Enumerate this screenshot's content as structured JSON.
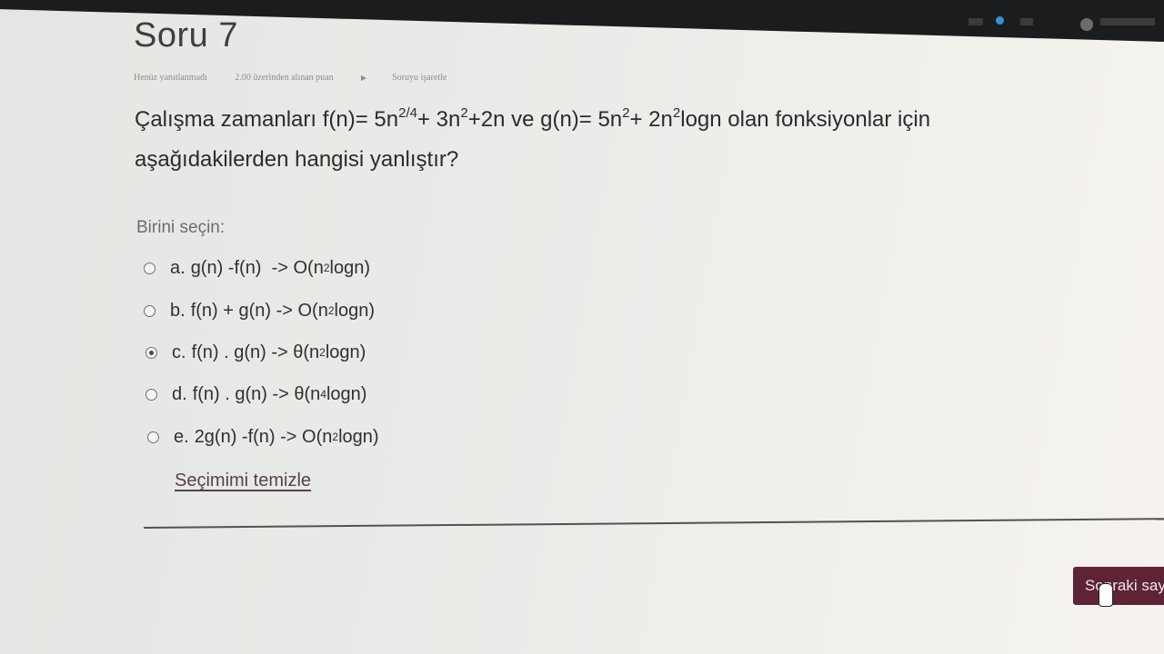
{
  "question": {
    "title": "Soru 7",
    "meta": {
      "status": "Henüz yanıtlanmadı",
      "score": "2.00 üzerinden alınan puan",
      "flag_label": "Soruyu işaretle"
    },
    "text_line1_prefix": "Çalışma zamanları f(n)= 5n",
    "text_sup1": "2/4",
    "text_mid1": "+ 3n",
    "text_sup2": "2",
    "text_mid2": "+2n ve g(n)= 5n",
    "text_sup3": "2",
    "text_mid3": "+ 2n",
    "text_sup4": "2",
    "text_line1_suffix": "logn olan fonksiyonlar için",
    "text_line2": "aşağıdakilerden hangisi yanlıştır?",
    "choose_label": "Birini seçin:"
  },
  "options": [
    {
      "letter": "a.",
      "pre": "g(n) -f(n)  -> O(n",
      "sup": "2",
      "post": "logn)",
      "selected": false
    },
    {
      "letter": "b.",
      "pre": "f(n) + g(n) -> O(n",
      "sup": "2",
      "post": "logn)",
      "selected": false
    },
    {
      "letter": "c.",
      "pre": "f(n) . g(n) -> θ(n",
      "sup": "2",
      "post": "logn)",
      "selected": true
    },
    {
      "letter": "d.",
      "pre": "f(n) . g(n) -> θ(n",
      "sup": "4",
      "post": "logn)",
      "selected": false
    },
    {
      "letter": "e.",
      "pre": "2g(n) -f(n) -> O(n",
      "sup": "2",
      "post": "logn)",
      "selected": false
    }
  ],
  "clear_label": "Seçimimi temizle",
  "next_label": "Sonraki say",
  "icons": {
    "flag": "flag-icon",
    "cursor": "hand-cursor-icon"
  }
}
